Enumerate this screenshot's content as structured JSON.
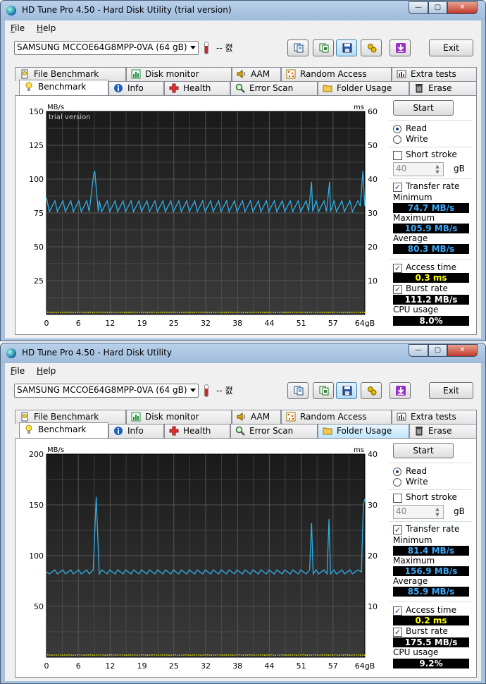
{
  "windows": [
    {
      "title": "HD Tune Pro 4.50 - Hard Disk Utility (trial version)",
      "menu": [
        {
          "key": "F",
          "rest": "ile"
        },
        {
          "key": "H",
          "rest": "elp"
        }
      ],
      "drive": "SAMSUNG MCCOE64G8MPP-0VA (64 gB)",
      "temperature": "-- 캜",
      "exit_label": "Exit",
      "tabs_back": [
        "File Benchmark",
        "Disk monitor",
        "AAM",
        "Random Access",
        "Extra tests"
      ],
      "tabs_front": [
        "Benchmark",
        "Info",
        "Health",
        "Error Scan",
        "Folder Usage",
        "Erase"
      ],
      "hover_tab": "",
      "start_label": "Start",
      "read_label": "Read",
      "write_label": "Write",
      "short_stroke_label": "Short stroke",
      "stroke_value": "40",
      "gb_label": "gB",
      "transfer_label": "Transfer rate",
      "min_label": "Minimum",
      "min_value": "74.7 MB/s",
      "max_label": "Maximum",
      "max_value": "105.9 MB/s",
      "avg_label": "Average",
      "avg_value": "80.3 MB/s",
      "access_label": "Access time",
      "access_value": "0.3 ms",
      "burst_label": "Burst rate",
      "burst_value": "111.2 MB/s",
      "cpu_label": "CPU usage",
      "cpu_value": "8.0%"
    },
    {
      "title": "HD Tune Pro 4.50 - Hard Disk Utility",
      "menu": [
        {
          "key": "F",
          "rest": "ile"
        },
        {
          "key": "H",
          "rest": "elp"
        }
      ],
      "drive": "SAMSUNG MCCOE64G8MPP-0VA (64 gB)",
      "temperature": "-- 캜",
      "exit_label": "Exit",
      "tabs_back": [
        "File Benchmark",
        "Disk monitor",
        "AAM",
        "Random Access",
        "Extra tests"
      ],
      "tabs_front": [
        "Benchmark",
        "Info",
        "Health",
        "Error Scan",
        "Folder Usage",
        "Erase"
      ],
      "hover_tab": "Folder Usage",
      "start_label": "Start",
      "read_label": "Read",
      "write_label": "Write",
      "short_stroke_label": "Short stroke",
      "stroke_value": "40",
      "gb_label": "gB",
      "transfer_label": "Transfer rate",
      "min_label": "Minimum",
      "min_value": "81.4 MB/s",
      "max_label": "Maximum",
      "max_value": "156.9 MB/s",
      "avg_label": "Average",
      "avg_value": "85.9 MB/s",
      "access_label": "Access time",
      "access_value": "0.2 ms",
      "burst_label": "Burst rate",
      "burst_value": "175.5 MB/s",
      "cpu_label": "CPU usage",
      "cpu_value": "9.2%"
    }
  ],
  "colors": {
    "transfer_line": "#2fb0e8",
    "access_points": "#e8e800",
    "plot_bg": "#242424",
    "grid": "#5a5a5a",
    "min_max_text": "#3fa9f5",
    "access_text": "#ffff00",
    "cpu_text": "#ffffff"
  },
  "chart_data": [
    {
      "type": "line",
      "watermark": "trial version",
      "left_unit": "MB/s",
      "right_unit": "ms",
      "ylim": [
        0,
        150
      ],
      "y2lim": [
        0,
        60
      ],
      "yticks": [
        "150",
        "125",
        "100",
        "75",
        "50",
        "25"
      ],
      "y2ticks": [
        "60",
        "50",
        "40",
        "30",
        "20",
        "10"
      ],
      "xticks": [
        "0",
        "6",
        "12",
        "19",
        "25",
        "32",
        "38",
        "44",
        "51",
        "57",
        "64gB"
      ],
      "xlim": [
        0,
        64
      ],
      "grid": true,
      "series": [
        {
          "x": [
            0,
            0.6,
            1.7,
            2.2,
            3.3,
            3.8,
            4.9,
            5.4,
            6.5,
            7.0,
            8.1,
            8.6,
            9.5,
            9.7,
            10.4,
            10.6,
            11.1,
            12.2,
            12.7,
            13.8,
            14.3,
            15.4,
            15.9,
            17.0,
            17.5,
            18.6,
            19.1,
            20.2,
            20.7,
            21.8,
            22.3,
            23.4,
            23.9,
            25.0,
            25.5,
            26.6,
            27.1,
            28.2,
            28.7,
            29.8,
            30.3,
            31.4,
            31.9,
            33.0,
            33.5,
            34.6,
            35.1,
            36.2,
            36.7,
            37.8,
            38.3,
            39.4,
            39.9,
            41.0,
            41.5,
            42.6,
            43.1,
            44.2,
            44.7,
            45.8,
            46.3,
            47.4,
            47.9,
            49.0,
            49.5,
            50.6,
            51.1,
            52.2,
            52.7,
            53.3,
            53.5,
            54.2,
            54.7,
            55.8,
            56.3,
            56.9,
            57.1,
            57.8,
            58.3,
            59.4,
            59.9,
            61.0,
            61.5,
            62.6,
            63.1,
            63.6,
            64
          ],
          "y": [
            86,
            76,
            84,
            76,
            84,
            76,
            84,
            76,
            84,
            76,
            84,
            76,
            104,
            106,
            76,
            84,
            76,
            84,
            76,
            84,
            76,
            84,
            76,
            84,
            76,
            84,
            76,
            84,
            76,
            84,
            76,
            84,
            76,
            84,
            76,
            84,
            76,
            84,
            76,
            84,
            76,
            84,
            76,
            84,
            76,
            84,
            76,
            84,
            76,
            84,
            76,
            84,
            76,
            84,
            76,
            84,
            76,
            84,
            76,
            84,
            76,
            84,
            76,
            84,
            76,
            84,
            76,
            84,
            76,
            98,
            76,
            84,
            76,
            84,
            76,
            98,
            76,
            84,
            76,
            84,
            76,
            84,
            76,
            84,
            80,
            106,
            80
          ]
        }
      ]
    },
    {
      "type": "line",
      "left_unit": "MB/s",
      "right_unit": "ms",
      "ylim": [
        0,
        200
      ],
      "y2lim": [
        0,
        40
      ],
      "yticks": [
        "200",
        "150",
        "100",
        "50"
      ],
      "y2ticks": [
        "40",
        "30",
        "20",
        "10"
      ],
      "xticks": [
        "0",
        "6",
        "12",
        "19",
        "25",
        "32",
        "38",
        "44",
        "51",
        "57",
        "64gB"
      ],
      "xlim": [
        0,
        64
      ],
      "grid": true,
      "series": [
        {
          "x": [
            0,
            0.6,
            1.7,
            2.2,
            3.3,
            3.8,
            4.9,
            5.4,
            6.5,
            7.0,
            8.1,
            8.6,
            9.4,
            10.0,
            10.6,
            11.1,
            12.2,
            12.7,
            13.8,
            14.3,
            15.4,
            15.9,
            17.0,
            17.5,
            18.6,
            19.1,
            20.2,
            20.7,
            21.8,
            22.3,
            23.4,
            23.9,
            25.0,
            25.5,
            26.6,
            27.1,
            28.2,
            28.7,
            29.8,
            30.3,
            31.4,
            31.9,
            33.0,
            33.5,
            34.6,
            35.1,
            36.2,
            36.7,
            37.8,
            38.3,
            39.4,
            39.9,
            41.0,
            41.5,
            42.6,
            43.1,
            44.2,
            44.7,
            45.8,
            46.3,
            47.4,
            47.9,
            49.0,
            49.5,
            50.6,
            51.1,
            52.2,
            52.9,
            53.3,
            53.6,
            54.2,
            54.7,
            55.8,
            56.4,
            56.8,
            57.1,
            57.8,
            58.3,
            59.4,
            59.9,
            61.0,
            61.5,
            62.6,
            63.3,
            63.7,
            64
          ],
          "y": [
            84,
            82,
            86,
            82,
            86,
            82,
            86,
            82,
            86,
            82,
            86,
            82,
            86,
            158,
            82,
            86,
            82,
            86,
            82,
            86,
            82,
            86,
            82,
            86,
            82,
            86,
            82,
            86,
            82,
            86,
            82,
            86,
            82,
            86,
            82,
            86,
            82,
            86,
            82,
            86,
            82,
            86,
            82,
            86,
            82,
            86,
            82,
            86,
            82,
            86,
            82,
            86,
            82,
            86,
            82,
            86,
            82,
            86,
            82,
            86,
            82,
            86,
            82,
            86,
            82,
            86,
            82,
            86,
            132,
            82,
            86,
            82,
            86,
            82,
            136,
            82,
            86,
            82,
            86,
            82,
            86,
            82,
            86,
            84,
            150,
            156
          ]
        }
      ]
    }
  ]
}
